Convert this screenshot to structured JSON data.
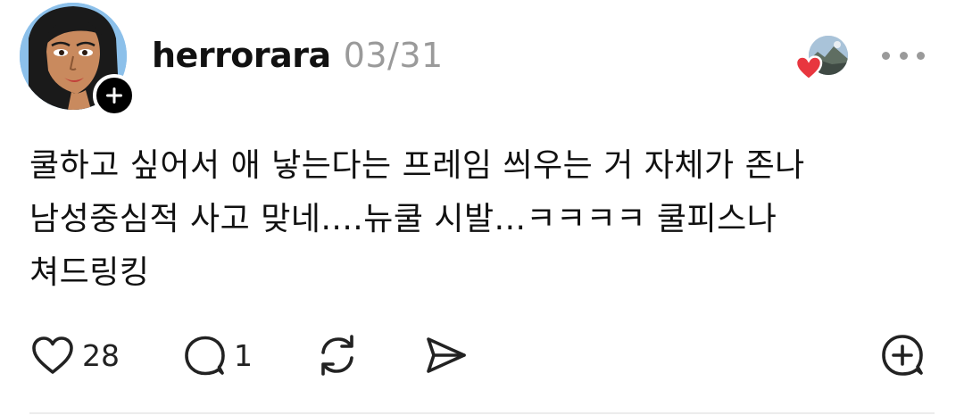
{
  "post": {
    "username": "herrorara",
    "timestamp": "03/31",
    "body_lines": [
      "쿨하고 싶어서 애 낳는다는 프레임 씌우는 거 자체가 존나",
      "남성중심적 사고 맞네....뉴쿨 시발...ㅋㅋㅋㅋ 쿨피스나",
      "쳐드링킹"
    ],
    "like_count": "28",
    "reply_count": "1"
  },
  "icons": {
    "follow": "plus-icon",
    "liked_by": "heart-icon",
    "more": "ellipsis-icon",
    "like": "heart-outline-icon",
    "reply": "speech-bubble-icon",
    "repost": "repost-icon",
    "share": "send-icon",
    "add": "plus-circle-icon"
  },
  "colors": {
    "heart_red": "#e8363f",
    "muted_text": "#9a9a9a",
    "text": "#111111"
  }
}
